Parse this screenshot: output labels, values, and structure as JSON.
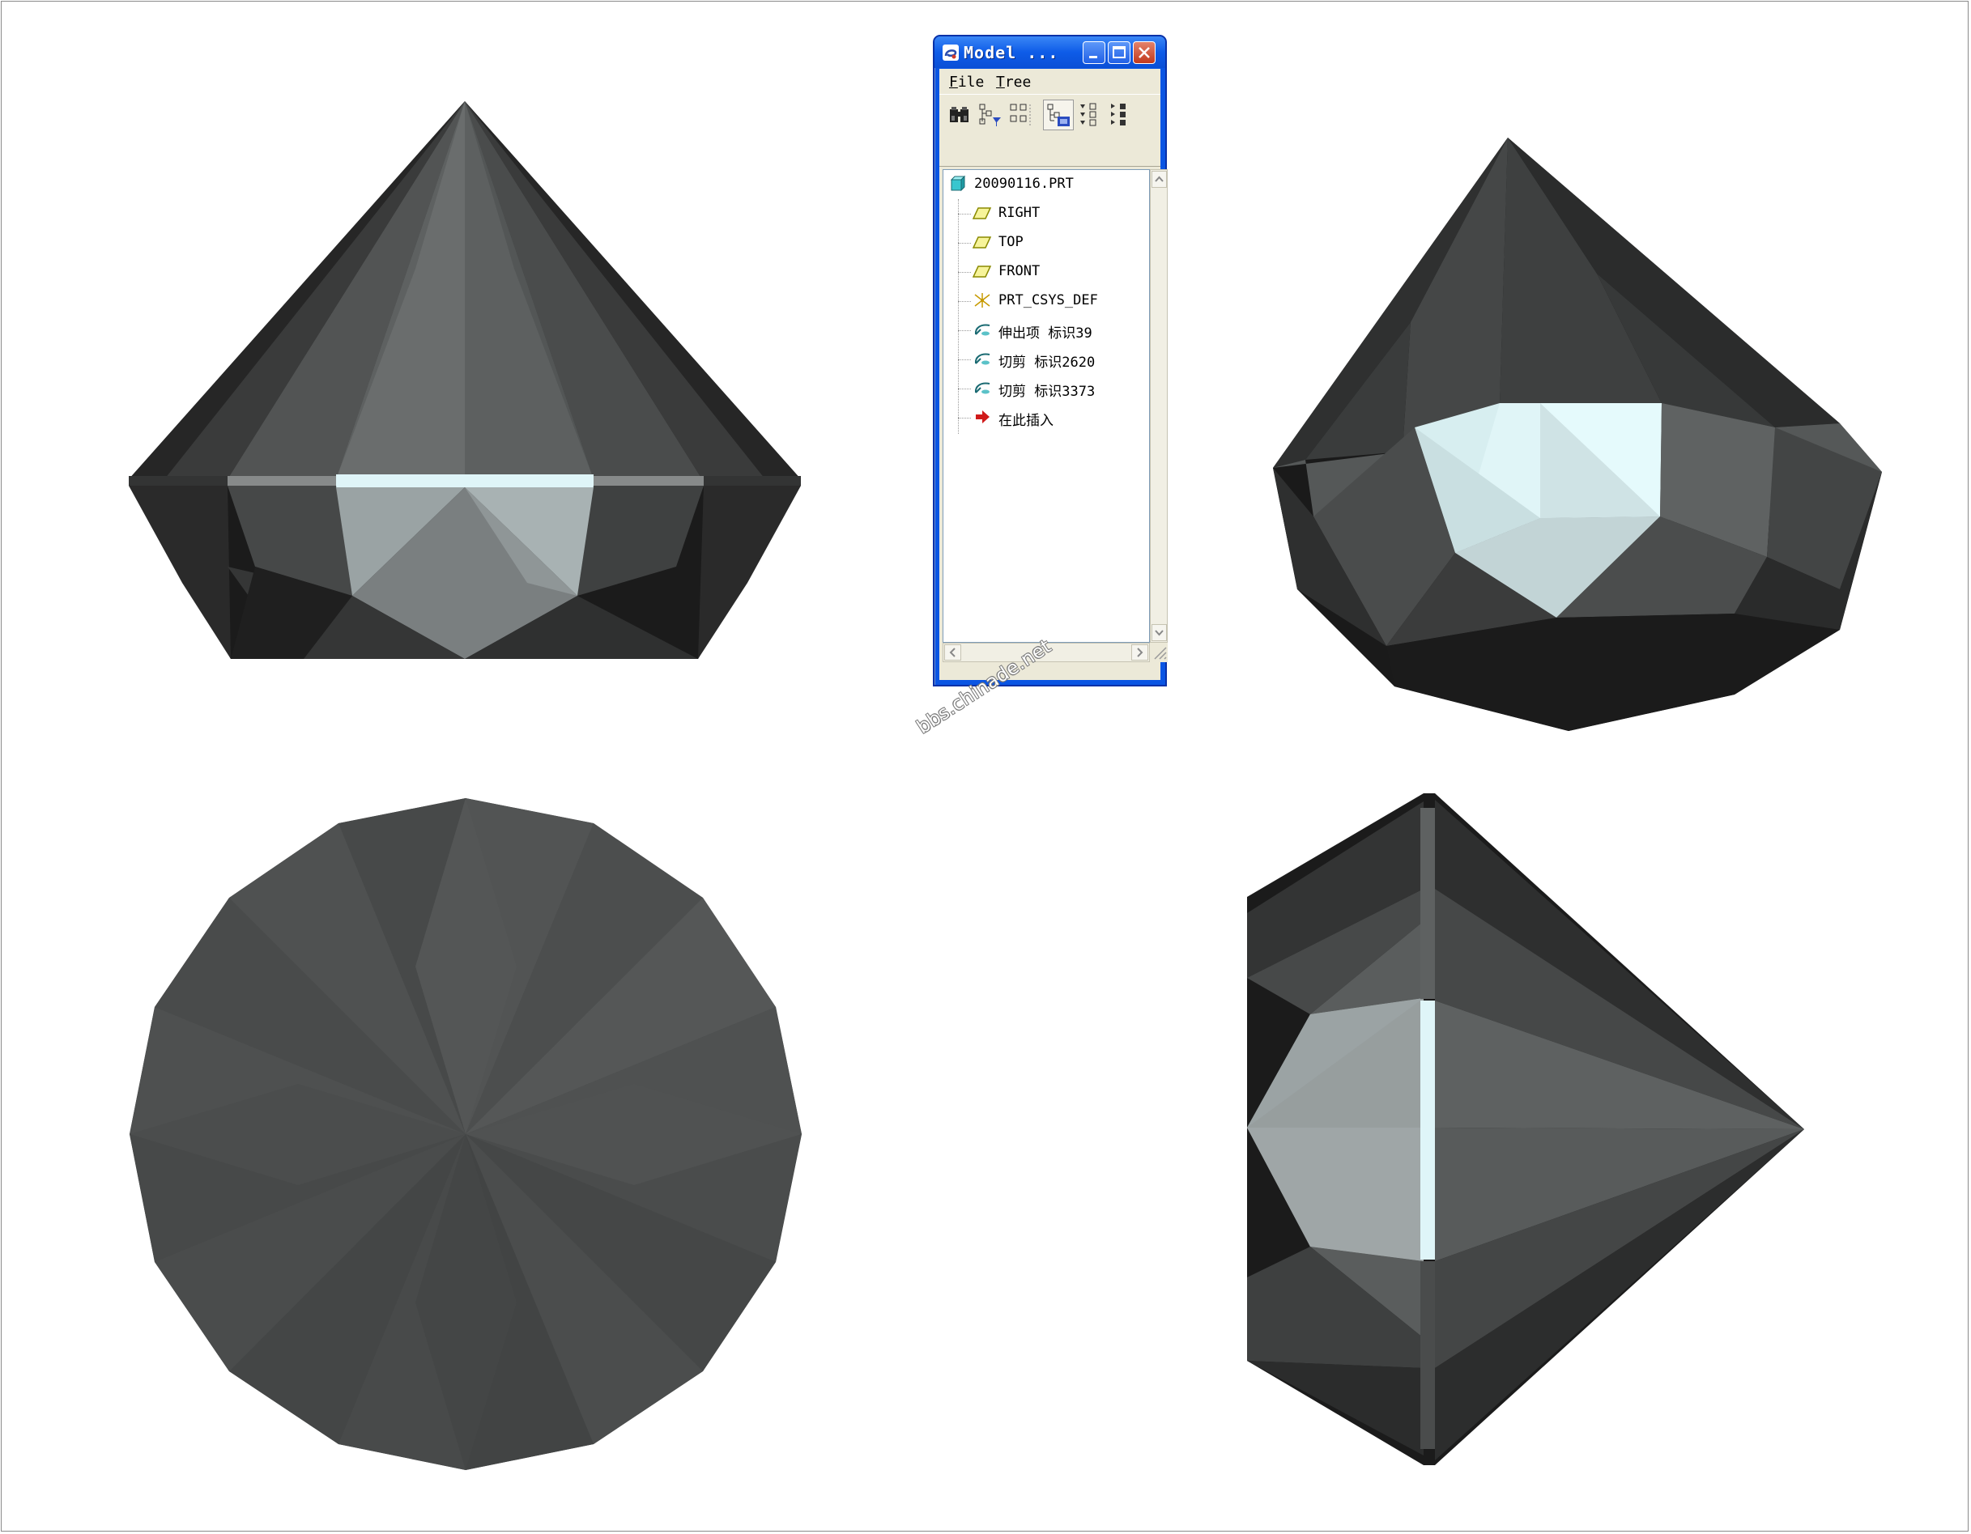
{
  "window": {
    "title": "Model ...",
    "menus": [
      {
        "label": "File",
        "accel": "F",
        "rest": "ile"
      },
      {
        "label": "Tree",
        "accel": "T",
        "rest": "ree"
      }
    ],
    "toolbar": [
      "find-icon",
      "tree-filter-icon",
      "tree-columns-icon",
      "show-model-tree-icon",
      "expand-tree-icon",
      "collapse-tree-icon"
    ]
  },
  "tree": {
    "root": "20090116.PRT",
    "items": [
      {
        "label": "RIGHT",
        "icon": "datum-plane-icon"
      },
      {
        "label": "TOP",
        "icon": "datum-plane-icon"
      },
      {
        "label": "FRONT",
        "icon": "datum-plane-icon"
      },
      {
        "label": "PRT_CSYS_DEF",
        "icon": "coordinate-system-icon"
      },
      {
        "label": "伸出项 标识39",
        "icon": "revolve-feature-icon"
      },
      {
        "label": "切剪 标识2620",
        "icon": "revolve-feature-icon"
      },
      {
        "label": "切剪 标识3373",
        "icon": "revolve-feature-icon"
      },
      {
        "label": "在此插入",
        "icon": "insert-here-arrow-icon"
      }
    ]
  },
  "watermark": "bbs.chinade.net",
  "colors": {
    "gem_dark": "#1a1a1a",
    "gem_mid": "#4d4f4f",
    "gem_light": "#6a6d6d",
    "gem_highlight": "#dff5f8",
    "title_blue": "#0a55e3",
    "window_face": "#ece9d8"
  }
}
